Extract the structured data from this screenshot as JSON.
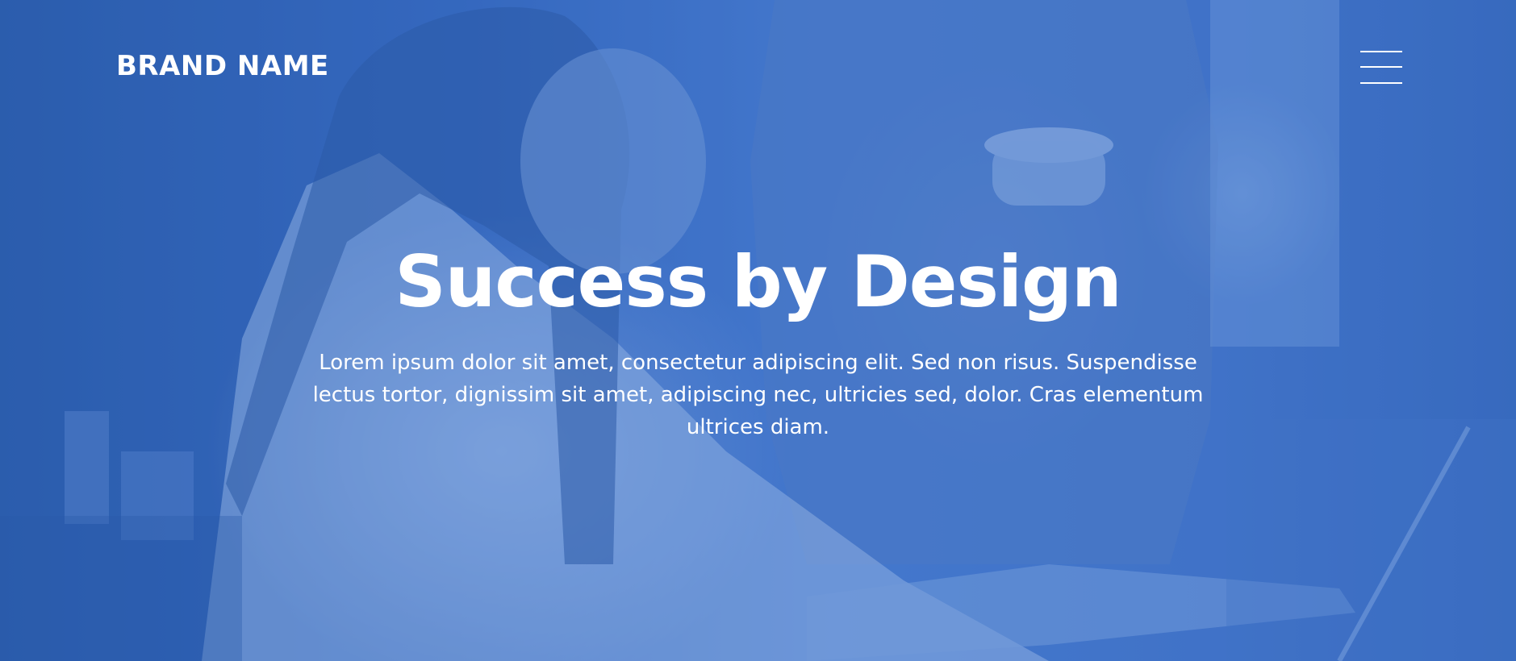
{
  "navbar": {
    "brand": "BRAND NAME",
    "menu_icon": "hamburger-menu-icon"
  },
  "hero": {
    "headline": "Success by Design",
    "description": "Lorem ipsum dolor sit amet, consectetur adipiscing elit. Sed non risus. Suspendisse lectus tortor, dignissim sit amet, adipiscing nec, ultricies sed, dolor. Cras elementum ultrices diam.",
    "overlay_color": "#3f72c4",
    "text_color": "#ffffff"
  }
}
